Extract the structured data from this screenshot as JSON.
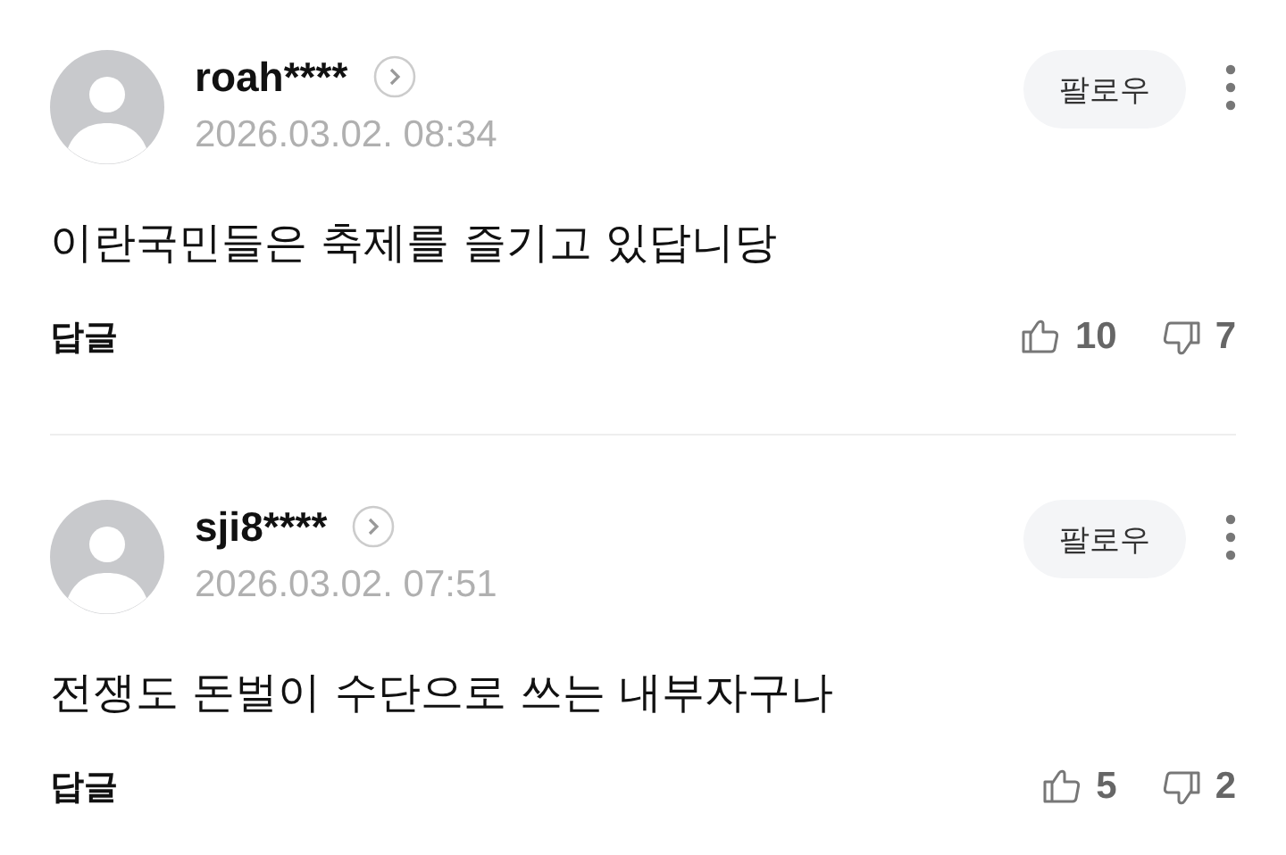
{
  "comments": [
    {
      "author": "roah****",
      "date": "2026.03.02. 08:34",
      "follow": "팔로우",
      "text": "이란국민들은 축제를 즐기고 있답니당",
      "reply": "답글",
      "likes": "10",
      "dislikes": "7"
    },
    {
      "author": "sji8****",
      "date": "2026.03.02. 07:51",
      "follow": "팔로우",
      "text": "전쟁도 돈벌이 수단으로 쓰는 내부자구나",
      "reply": "답글",
      "likes": "5",
      "dislikes": "2"
    }
  ]
}
